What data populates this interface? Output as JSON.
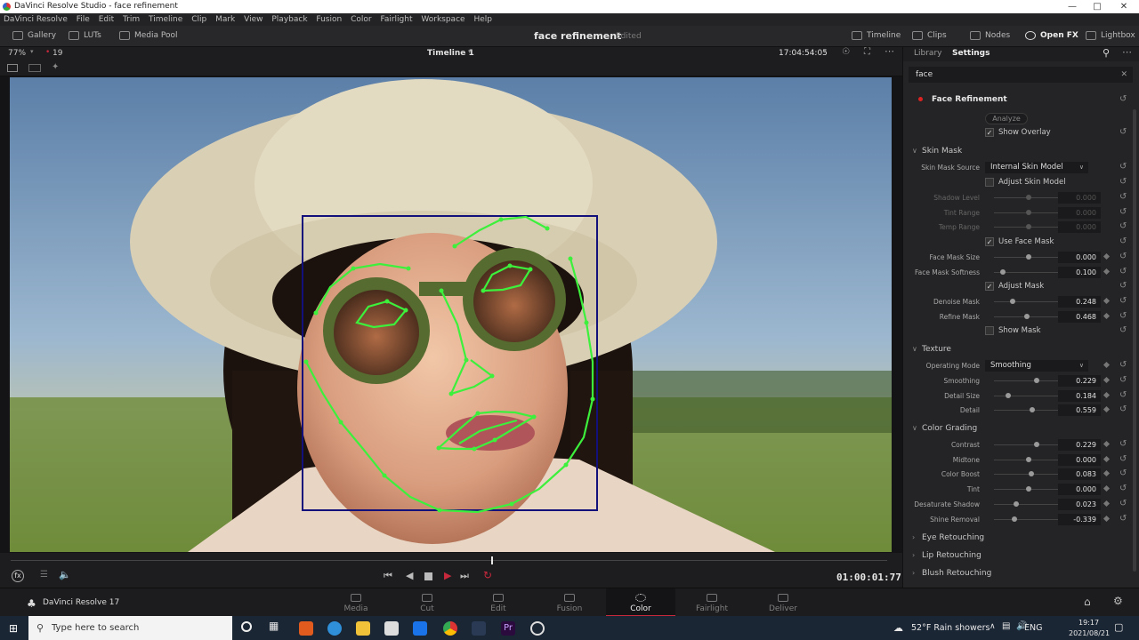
{
  "window": {
    "title": "DaVinci Resolve Studio - face refinement"
  },
  "menu": [
    "DaVinci Resolve",
    "File",
    "Edit",
    "Trim",
    "Timeline",
    "Clip",
    "Mark",
    "View",
    "Playback",
    "Fusion",
    "Color",
    "Fairlight",
    "Workspace",
    "Help"
  ],
  "toolbar": {
    "left": [
      "Gallery",
      "LUTs",
      "Media Pool"
    ],
    "project_title": "face refinement",
    "project_status": "Edited",
    "right": [
      "Timeline",
      "Clips",
      "Nodes",
      "Open FX",
      "Lightbox"
    ]
  },
  "viewer": {
    "zoom": "77%",
    "clip_count": "19",
    "timeline_name": "Timeline 1",
    "source_timecode": "17:04:54:05",
    "playhead_timecode": "01:00:01:77"
  },
  "panel": {
    "tabs": [
      "Library",
      "Settings"
    ],
    "search_value": "face",
    "effect_name": "Face Refinement",
    "analyze_label": "Analyze",
    "show_overlay": "Show Overlay",
    "sections": {
      "skin_mask": "Skin Mask",
      "texture": "Texture",
      "color_grading": "Color Grading",
      "eye": "Eye Retouching",
      "lip": "Lip Retouching",
      "blush": "Blush Retouching"
    },
    "skin_mask_source_label": "Skin Mask Source",
    "skin_mask_source_value": "Internal Skin Model",
    "adjust_skin_model": "Adjust Skin Model",
    "dim_params": [
      {
        "label": "Shadow Level",
        "value": "0.000",
        "pos": 0.5
      },
      {
        "label": "Tint Range",
        "value": "0.000",
        "pos": 0.5
      },
      {
        "label": "Temp Range",
        "value": "0.000",
        "pos": 0.5
      }
    ],
    "use_face_mask": "Use Face Mask",
    "face_mask_params": [
      {
        "label": "Face Mask Size",
        "value": "0.000",
        "pos": 0.5
      },
      {
        "label": "Face Mask Softness",
        "value": "0.100",
        "pos": 0.1
      }
    ],
    "adjust_mask": "Adjust Mask",
    "mask_params": [
      {
        "label": "Denoise Mask",
        "value": "0.248",
        "pos": 0.25
      },
      {
        "label": "Refine Mask",
        "value": "0.468",
        "pos": 0.47
      }
    ],
    "show_mask": "Show Mask",
    "operating_mode_label": "Operating Mode",
    "operating_mode_value": "Smoothing",
    "texture_params": [
      {
        "label": "Smoothing",
        "value": "0.229",
        "pos": 0.63
      },
      {
        "label": "Detail Size",
        "value": "0.184",
        "pos": 0.18
      },
      {
        "label": "Detail",
        "value": "0.559",
        "pos": 0.56
      }
    ],
    "grading_params": [
      {
        "label": "Contrast",
        "value": "0.229",
        "pos": 0.63
      },
      {
        "label": "Midtone",
        "value": "0.000",
        "pos": 0.5
      },
      {
        "label": "Color Boost",
        "value": "0.083",
        "pos": 0.54
      },
      {
        "label": "Tint",
        "value": "0.000",
        "pos": 0.5
      },
      {
        "label": "Desaturate Shadow",
        "value": "0.023",
        "pos": 0.3
      },
      {
        "label": "Shine Removal",
        "value": "-0.339",
        "pos": 0.28
      }
    ]
  },
  "pages": {
    "app_name": "DaVinci Resolve 17",
    "items": [
      "Media",
      "Cut",
      "Edit",
      "Fusion",
      "Color",
      "Fairlight",
      "Deliver"
    ],
    "active": "Color"
  },
  "taskbar": {
    "search_placeholder": "Type here to search",
    "weather": "52°F  Rain showers",
    "lang": "ENG",
    "time": "19:17",
    "date": "2021/08/21"
  }
}
